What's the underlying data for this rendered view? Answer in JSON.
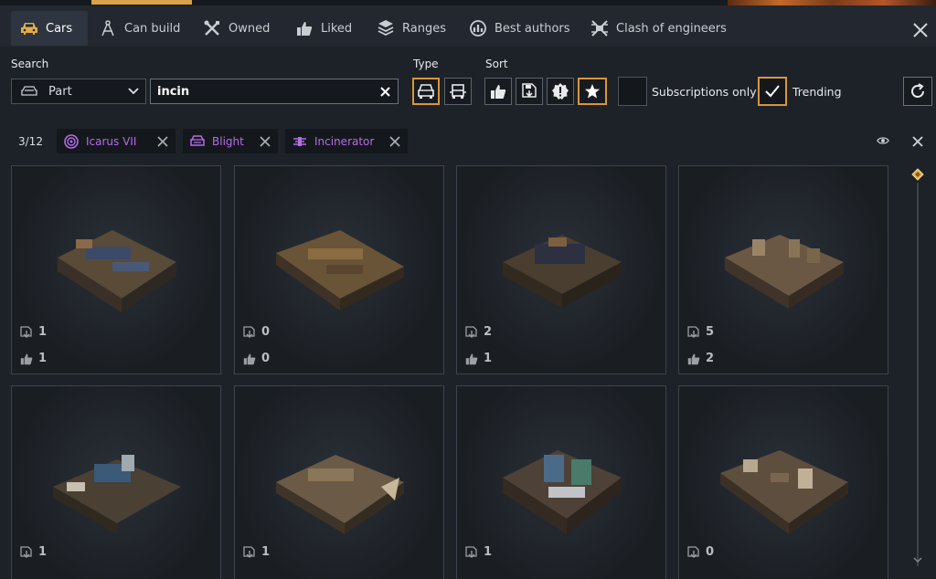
{
  "tabs": [
    {
      "label": "Cars",
      "icon": "car-icon"
    },
    {
      "label": "Can build",
      "icon": "compass-icon"
    },
    {
      "label": "Owned",
      "icon": "tools-icon"
    },
    {
      "label": "Liked",
      "icon": "thumbs-up-icon"
    },
    {
      "label": "Ranges",
      "icon": "ranges-icon"
    },
    {
      "label": "Best authors",
      "icon": "medal-icon"
    },
    {
      "label": "Clash of engineers",
      "icon": "clash-icon"
    }
  ],
  "filters": {
    "search_label": "Search",
    "select_value": "Part",
    "search_value": "incin",
    "type_label": "Type",
    "sort_label": "Sort",
    "subscriptions_label": "Subscriptions only",
    "subscriptions_checked": false,
    "trending_label": "Trending",
    "trending_checked": true
  },
  "active_filters": {
    "count": "3/12",
    "chips": [
      {
        "label": "Icarus VII",
        "icon": "icarus-icon"
      },
      {
        "label": "Blight",
        "icon": "blight-icon"
      },
      {
        "label": "Incinerator",
        "icon": "incinerator-icon"
      }
    ]
  },
  "cards": [
    {
      "downloads": "1",
      "likes": "1"
    },
    {
      "downloads": "0",
      "likes": "0"
    },
    {
      "downloads": "2",
      "likes": "1"
    },
    {
      "downloads": "5",
      "likes": "2"
    },
    {
      "downloads": "1",
      "likes": ""
    },
    {
      "downloads": "1",
      "likes": ""
    },
    {
      "downloads": "1",
      "likes": ""
    },
    {
      "downloads": "0",
      "likes": ""
    }
  ],
  "colors": {
    "accent": "#d9963a",
    "chip_text": "#b56be6",
    "bg": "#1d2229"
  }
}
